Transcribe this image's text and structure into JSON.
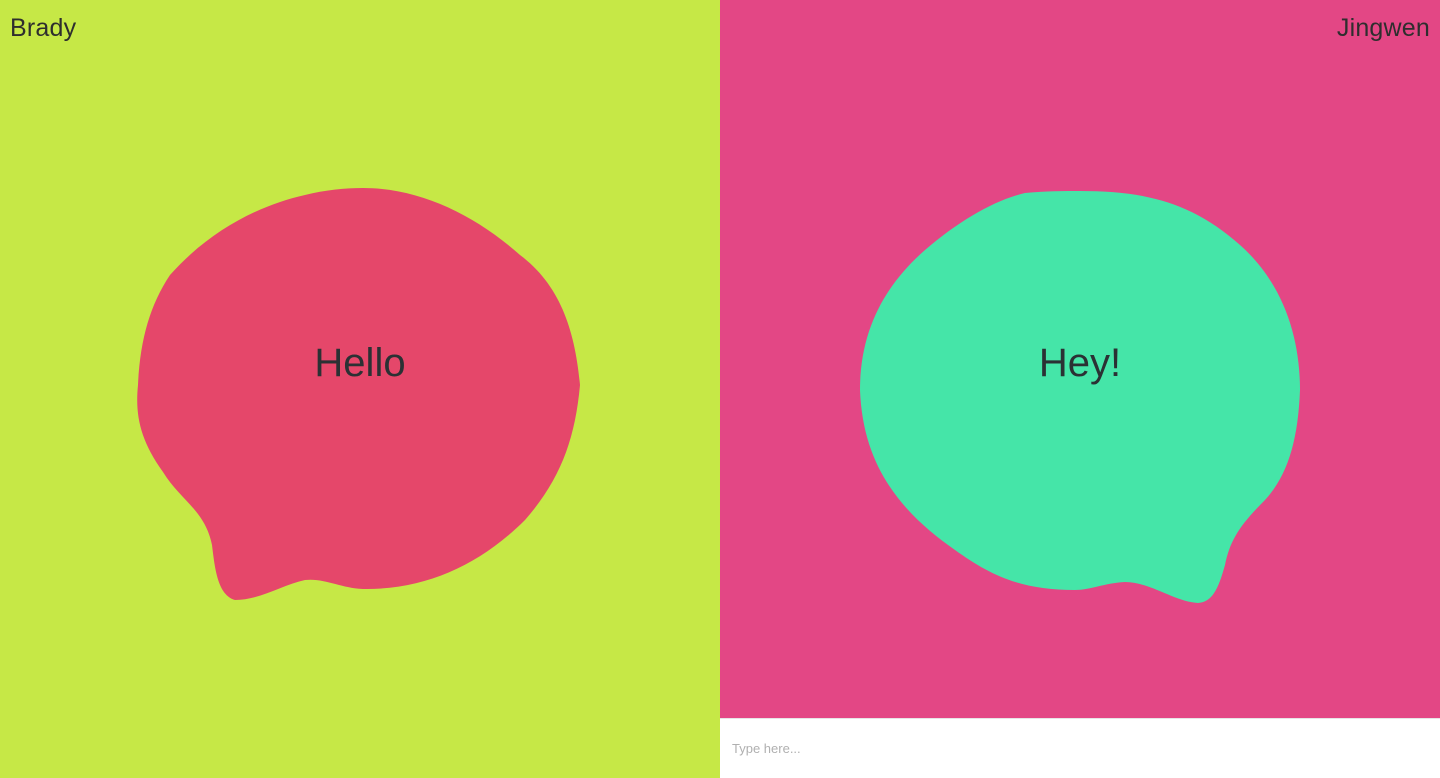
{
  "colors": {
    "left_panel": "#C6E846",
    "right_panel": "#E34785",
    "left_bubble": "#E5476A",
    "right_bubble": "#45E5A8"
  },
  "users": {
    "left": {
      "name": "Brady"
    },
    "right": {
      "name": "Jingwen"
    }
  },
  "messages": {
    "left": {
      "text": "Hello"
    },
    "right": {
      "text": "Hey!"
    }
  },
  "composer": {
    "placeholder": "Type here...",
    "value": ""
  }
}
